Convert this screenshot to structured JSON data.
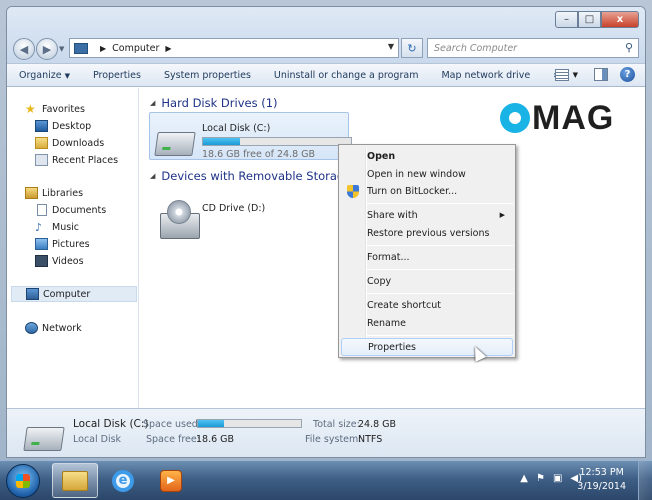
{
  "window": {
    "address": {
      "segment": "Computer"
    },
    "search_placeholder": "Search Computer",
    "caption_buttons": {
      "minimize": "–",
      "maximize": "□",
      "close": "x"
    }
  },
  "toolbar": {
    "organize": "Organize",
    "properties": "Properties",
    "system_properties": "System properties",
    "uninstall": "Uninstall or change a program",
    "map_drive": "Map network drive",
    "more": "»"
  },
  "nav": {
    "favorites": "Favorites",
    "desktop": "Desktop",
    "downloads": "Downloads",
    "recent": "Recent Places",
    "libraries": "Libraries",
    "documents": "Documents",
    "music": "Music",
    "pictures": "Pictures",
    "videos": "Videos",
    "computer": "Computer",
    "network": "Network"
  },
  "content": {
    "group_hdd": "Hard Disk Drives (1)",
    "group_removable": "Devices with Removable Storage (",
    "local_disk": {
      "name": "Local Disk (C:)",
      "free_text": "18.6 GB free of 24.8 GB",
      "used_fraction": 0.25
    },
    "cd_drive": {
      "name": "CD Drive (D:)"
    }
  },
  "context_menu": {
    "open": "Open",
    "open_new_window": "Open in new window",
    "bitlocker": "Turn on BitLocker...",
    "share_with": "Share with",
    "restore": "Restore previous versions",
    "format": "Format...",
    "copy": "Copy",
    "create_shortcut": "Create shortcut",
    "rename": "Rename",
    "properties": "Properties"
  },
  "details": {
    "name": "Local Disk (C:)",
    "type": "Local Disk",
    "space_used_label": "Space used:",
    "space_free_label": "Space free:",
    "space_free": "18.6 GB",
    "total_size_label": "Total size:",
    "total_size": "24.8 GB",
    "fs_label": "File system:",
    "fs": "NTFS",
    "used_fraction": 0.25
  },
  "taskbar": {
    "time": "12:53 PM",
    "date": "3/19/2014",
    "ie_letter": "e"
  },
  "watermark": {
    "text": "MAG"
  },
  "colors": {
    "accent": "#1e3287",
    "bar_fill": "#1a9ad8",
    "logo_blue": "#19b3e6"
  },
  "icons": [
    "back-icon",
    "forward-icon",
    "refresh-icon",
    "search-icon",
    "help-icon",
    "star-icon",
    "drive-icon",
    "cd-icon",
    "shield-icon"
  ]
}
